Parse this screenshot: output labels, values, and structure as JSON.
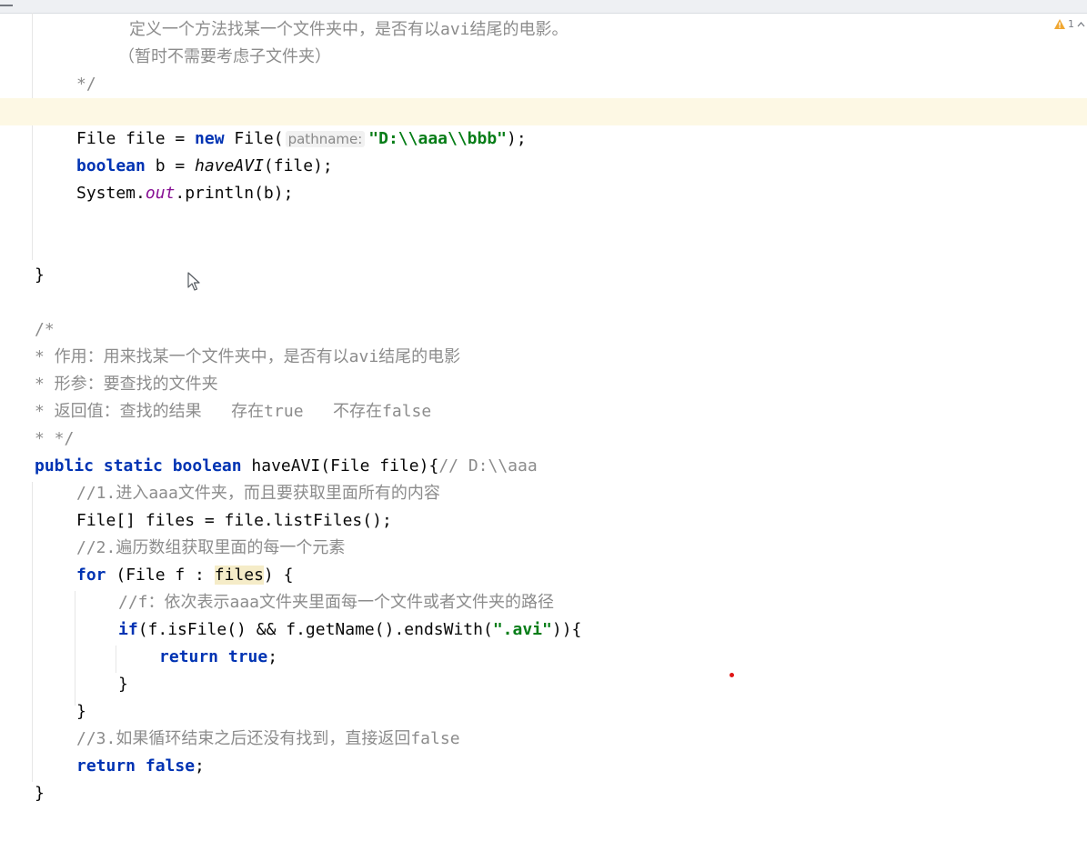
{
  "inspections": {
    "warning_count": "1"
  },
  "colors": {
    "keyword": "#0033b3",
    "string": "#067d17",
    "comment": "#8c8c8c",
    "static_field": "#871094",
    "current_line": "#fdf8e4",
    "usage_highlight": "#f5ecc8",
    "warning": "#f0a732"
  },
  "code": {
    "l1_comment": "定义一个方法找某一个文件夹中，是否有以avi结尾的电影。",
    "l2_comment": "（暂时不需要考虑子文件夹）",
    "l3_comment": "*/",
    "l5_a": "File file = ",
    "l5_new": "new",
    "l5_b": " File(",
    "l5_hint": "pathname:",
    "l5_str": "\"D:\\\\aaa\\\\bbb\"",
    "l5_c": ");",
    "l6_kw": "boolean",
    "l6_a": " b = ",
    "l6_method": "haveAVI",
    "l6_b": "(file);",
    "l7_a": "System.",
    "l7_field": "out",
    "l7_b": ".println(b);",
    "l10_brace": "}",
    "l12": "/*",
    "l13": "* 作用：用来找某一个文件夹中，是否有以avi结尾的电影",
    "l14": "* 形参：要查找的文件夹",
    "l15": "* 返回值：查找的结果   存在true   不存在false",
    "l16": "* */",
    "l17_kw": "public static boolean",
    "l17_a": " haveAVI(File file){",
    "l17_cmt": "// D:\\\\aaa",
    "l18": "//1.进入aaa文件夹，而且要获取里面所有的内容",
    "l19": "File[] files = file.listFiles();",
    "l20": "//2.遍历数组获取里面的每一个元素",
    "l21_kw": "for",
    "l21_a": " (File f : ",
    "l21_usage": "files",
    "l21_b": ") {",
    "l22": "//f：依次表示aaa文件夹里面每一个文件或者文件夹的路径",
    "l23_kw": "if",
    "l23_a": "(f.isFile() && f.getName().endsWith(",
    "l23_str": "\".avi\"",
    "l23_b": ")){",
    "l24_kw": "return true",
    "l24_a": ";",
    "l25": "}",
    "l26": "}",
    "l27": "//3.如果循环结束之后还没有找到，直接返回false",
    "l28_kw": "return false",
    "l28_a": ";",
    "l29": "}"
  }
}
